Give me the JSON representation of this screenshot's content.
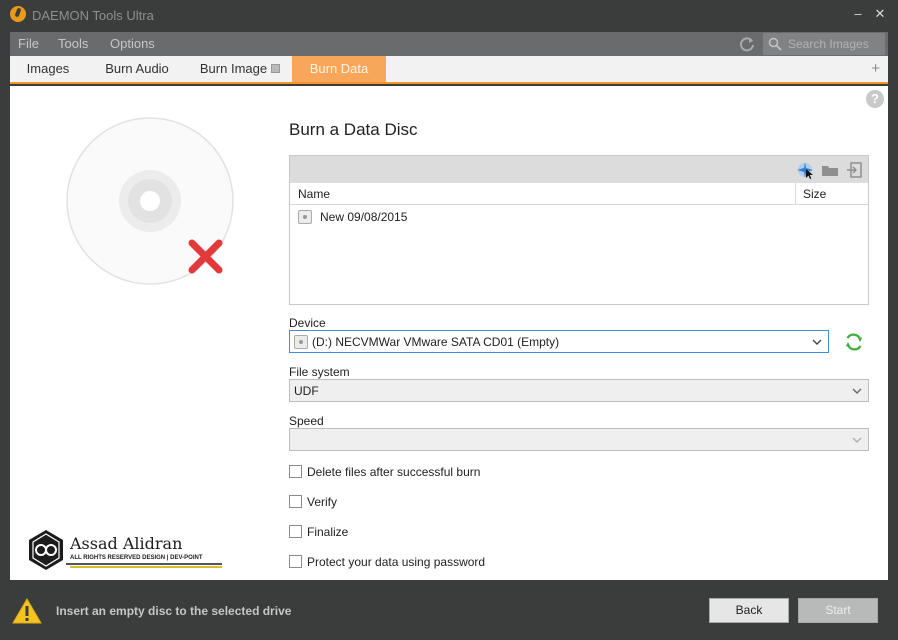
{
  "window": {
    "title": "DAEMON Tools Ultra"
  },
  "menu": {
    "items": [
      "File",
      "Tools",
      "Options"
    ],
    "search_placeholder": "Search Images"
  },
  "tabs": [
    {
      "label": "Images"
    },
    {
      "label": "Burn Audio"
    },
    {
      "label": "Burn Image"
    },
    {
      "label": "Burn Data"
    }
  ],
  "main": {
    "heading": "Burn a Data Disc",
    "columns": {
      "name": "Name",
      "size": "Size"
    },
    "file_rows": [
      {
        "name": "New 09/08/2015"
      }
    ],
    "device": {
      "label": "Device",
      "value": "(D:) NECVMWar VMware SATA CD01 (Empty)"
    },
    "file_system": {
      "label": "File system",
      "value": "UDF"
    },
    "speed": {
      "label": "Speed",
      "value": ""
    },
    "options": [
      {
        "label": "Delete files after successful burn",
        "checked": false
      },
      {
        "label": "Verify",
        "checked": false
      },
      {
        "label": "Finalize",
        "checked": false
      },
      {
        "label": "Protect your data using password",
        "checked": false
      }
    ]
  },
  "watermark": {
    "name": "Assad Alidran",
    "tagline": "ALL RIGHTS RESERVED DESIGN | DEV-POINT"
  },
  "status": {
    "message": "Insert an empty disc to the selected drive",
    "back_label": "Back",
    "start_label": "Start"
  },
  "colors": {
    "accent": "#f5962b",
    "active_tab": "#f7a65a",
    "error": "#e23a3a",
    "refresh_green": "#3fae3f"
  }
}
